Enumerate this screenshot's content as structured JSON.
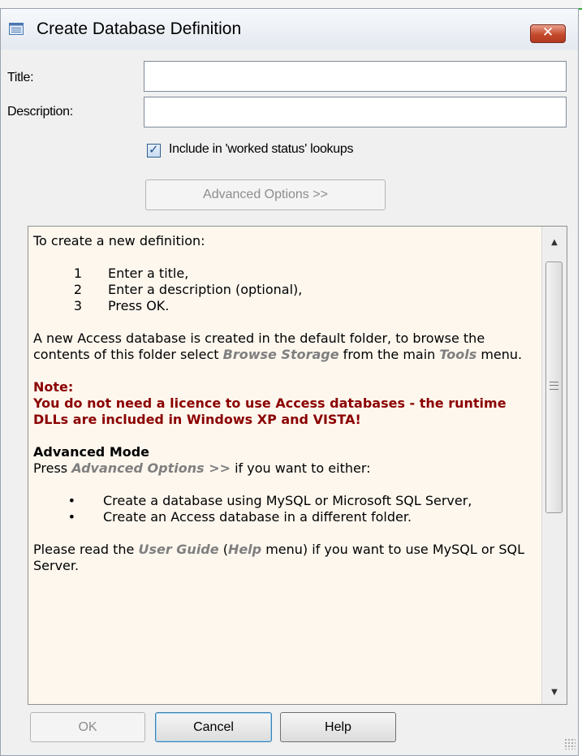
{
  "window": {
    "title": "Create Database Definition",
    "close_label": "✕"
  },
  "form": {
    "title_label": "Title:",
    "title_value": "",
    "description_label": "Description:",
    "description_value": "",
    "worked_status_label": "Include in 'worked status' lookups",
    "worked_status_checked": true,
    "advanced_button": "Advanced Options >>"
  },
  "info": {
    "intro": "To create a new definition:",
    "steps": [
      {
        "num": "1",
        "text": "Enter a title,"
      },
      {
        "num": "2",
        "text": "Enter a description (optional),"
      },
      {
        "num": "3",
        "text": "Press OK."
      }
    ],
    "para1_a": "A new Access database is created in the default folder, to browse the contents of this folder select ",
    "para1_link1": "Browse Storage",
    "para1_b": " from the main ",
    "para1_link2": "Tools",
    "para1_c": " menu.",
    "note_heading": "Note:",
    "note_text": "You do not need a licence to use Access databases - the runtime DLLs are included in Windows XP and VISTA!",
    "advanced_heading": "Advanced Mode",
    "advanced_a": "Press ",
    "advanced_link": "Advanced Options >>",
    "advanced_b": " if you want to either:",
    "bullets": [
      "Create a database using MySQL or Microsoft SQL Server,",
      "Create an Access database in a different folder."
    ],
    "bullet_char": "•",
    "guide_a": "Please read the ",
    "guide_link1": "User Guide",
    "guide_b": " (",
    "guide_link2": "Help",
    "guide_c": " menu) if you want to use MySQL or SQL Server."
  },
  "buttons": {
    "ok": "OK",
    "cancel": "Cancel",
    "help": "Help"
  },
  "colors": {
    "note": "#8b0000",
    "info_background": "#fdf7ee",
    "close_button": "#c44a2c"
  },
  "icons": {
    "app": "database-form-icon",
    "close": "close-icon",
    "check": "checkmark-icon",
    "scroll_up": "scroll-up-arrow",
    "scroll_down": "scroll-down-arrow"
  }
}
